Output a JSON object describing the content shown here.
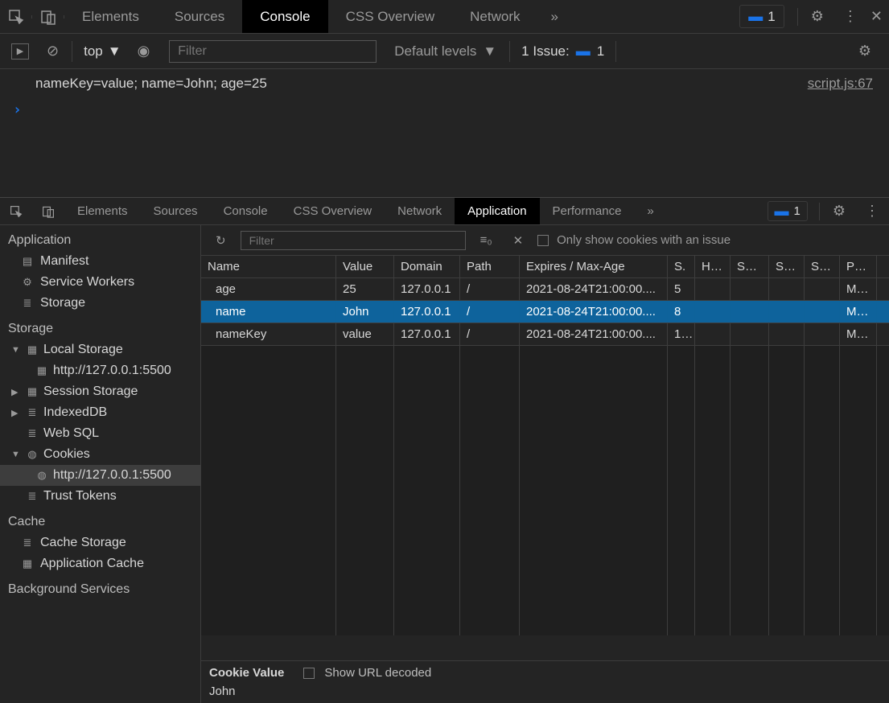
{
  "top": {
    "tabs": [
      "Elements",
      "Sources",
      "Console",
      "CSS Overview",
      "Network"
    ],
    "active_tab": "Console",
    "badge_count": "1",
    "toolbar": {
      "context": "top",
      "filter_placeholder": "Filter",
      "levels_label": "Default levels",
      "issues_label": "1 Issue:",
      "issues_count": "1"
    },
    "log_line": "nameKey=value; name=John; age=25",
    "source_ref": "script.js:67",
    "prompt": "›"
  },
  "bottom": {
    "tabs": [
      "Elements",
      "Sources",
      "Console",
      "CSS Overview",
      "Network",
      "Application",
      "Performance"
    ],
    "active_tab": "Application",
    "badge_count": "1",
    "sidebar": {
      "groups": [
        {
          "label": "Application",
          "items": [
            {
              "icon": "file",
              "label": "Manifest"
            },
            {
              "icon": "gear",
              "label": "Service Workers"
            },
            {
              "icon": "db",
              "label": "Storage"
            }
          ]
        },
        {
          "label": "Storage",
          "trees": [
            {
              "arrow": "▼",
              "icon": "grid",
              "label": "Local Storage",
              "children": [
                {
                  "icon": "grid",
                  "label": "http://127.0.0.1:5500",
                  "sel": false
                }
              ]
            },
            {
              "arrow": "▶",
              "icon": "grid",
              "label": "Session Storage"
            },
            {
              "arrow": "▶",
              "icon": "db",
              "label": "IndexedDB"
            },
            {
              "arrow": "",
              "icon": "db",
              "label": "Web SQL"
            },
            {
              "arrow": "▼",
              "icon": "cookie",
              "label": "Cookies",
              "children": [
                {
                  "icon": "cookie",
                  "label": "http://127.0.0.1:5500",
                  "sel": true
                }
              ]
            },
            {
              "arrow": "",
              "icon": "db",
              "label": "Trust Tokens"
            }
          ]
        },
        {
          "label": "Cache",
          "items": [
            {
              "icon": "db",
              "label": "Cache Storage"
            },
            {
              "icon": "grid",
              "label": "Application Cache"
            }
          ]
        },
        {
          "label": "Background Services",
          "items": []
        }
      ]
    },
    "content_toolbar": {
      "filter_placeholder": "Filter",
      "only_issue_label": "Only show cookies with an issue"
    },
    "columns": [
      "Name",
      "Value",
      "Domain",
      "Path",
      "Expires / Max-Age",
      "S.",
      "Htt...",
      "Sec...",
      "Sa...",
      "Sa...",
      "Pri..."
    ],
    "rows": [
      {
        "name": "age",
        "value": "25",
        "domain": "127.0.0.1",
        "path": "/",
        "expires": "2021-08-24T21:00:00....",
        "size": "5",
        "pri": "Me...",
        "sel": false
      },
      {
        "name": "name",
        "value": "John",
        "domain": "127.0.0.1",
        "path": "/",
        "expires": "2021-08-24T21:00:00....",
        "size": "8",
        "pri": "Me...",
        "sel": true
      },
      {
        "name": "nameKey",
        "value": "value",
        "domain": "127.0.0.1",
        "path": "/",
        "expires": "2021-08-24T21:00:00....",
        "size": "1...",
        "pri": "Me...",
        "sel": false
      }
    ],
    "footer": {
      "label": "Cookie Value",
      "decoded_label": "Show URL decoded",
      "value": "John"
    }
  }
}
